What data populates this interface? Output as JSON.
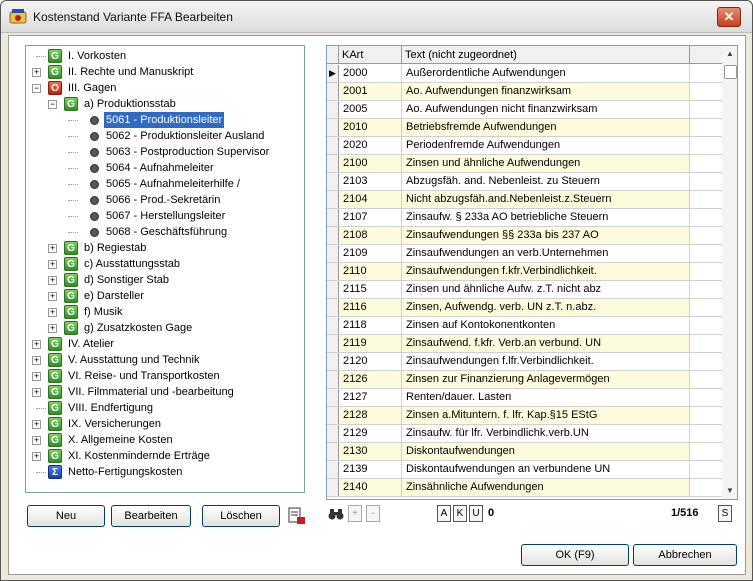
{
  "window": {
    "title": "Kostenstand Variante FFA Bearbeiten",
    "close_label": "✕"
  },
  "tree": [
    {
      "label": "I. Vorkosten",
      "icon": "G",
      "color": "green",
      "exp": "",
      "level": 0
    },
    {
      "label": "II. Rechte und Manuskript",
      "icon": "G",
      "color": "green",
      "exp": "+",
      "level": 0
    },
    {
      "label": "III. Gagen",
      "icon": "O",
      "color": "red",
      "exp": "−",
      "level": 0
    },
    {
      "label": "a) Produktionsstab",
      "icon": "G",
      "color": "green",
      "exp": "−",
      "level": 1
    },
    {
      "label": "5061 - Produktionsleiter",
      "icon": "radio",
      "level": 2,
      "selected": true
    },
    {
      "label": "5062 - Produktionsleiter Ausland",
      "icon": "radio",
      "level": 2
    },
    {
      "label": "5063 - Postproduction Supervisor",
      "icon": "radio",
      "level": 2
    },
    {
      "label": "5064 - Aufnahmeleiter",
      "icon": "radio",
      "level": 2
    },
    {
      "label": "5065 - Aufnahmeleiterhilfe /",
      "icon": "radio",
      "level": 2
    },
    {
      "label": "5066 - Prod.-Sekretärin",
      "icon": "radio",
      "level": 2
    },
    {
      "label": "5067 - Herstellungsleiter",
      "icon": "radio",
      "level": 2
    },
    {
      "label": "5068 - Geschäftsführung",
      "icon": "radio",
      "level": 2
    },
    {
      "label": "b) Regiestab",
      "icon": "G",
      "color": "green",
      "exp": "+",
      "level": 1
    },
    {
      "label": "c) Ausstattungsstab",
      "icon": "G",
      "color": "green",
      "exp": "+",
      "level": 1
    },
    {
      "label": "d) Sonstiger Stab",
      "icon": "G",
      "color": "green",
      "exp": "+",
      "level": 1
    },
    {
      "label": "e) Darsteller",
      "icon": "G",
      "color": "green",
      "exp": "+",
      "level": 1
    },
    {
      "label": "f) Musik",
      "icon": "G",
      "color": "green",
      "exp": "+",
      "level": 1
    },
    {
      "label": "g) Zusatzkosten Gage",
      "icon": "G",
      "color": "green",
      "exp": "+",
      "level": 1
    },
    {
      "label": "IV. Atelier",
      "icon": "G",
      "color": "green",
      "exp": "+",
      "level": 0
    },
    {
      "label": "V. Ausstattung und Technik",
      "icon": "G",
      "color": "green",
      "exp": "+",
      "level": 0
    },
    {
      "label": "VI. Reise- und Transportkosten",
      "icon": "G",
      "color": "green",
      "exp": "+",
      "level": 0
    },
    {
      "label": "VII. Filmmaterial und -bearbeitung",
      "icon": "G",
      "color": "green",
      "exp": "+",
      "level": 0
    },
    {
      "label": "VIII. Endfertigung",
      "icon": "G",
      "color": "green",
      "exp": "",
      "level": 0
    },
    {
      "label": "IX. Versicherungen",
      "icon": "G",
      "color": "green",
      "exp": "+",
      "level": 0
    },
    {
      "label": "X. Allgemeine Kosten",
      "icon": "G",
      "color": "green",
      "exp": "+",
      "level": 0
    },
    {
      "label": "XI. Kostenmindernde Erträge",
      "icon": "G",
      "color": "green",
      "exp": "+",
      "level": 0
    },
    {
      "label": "Netto-Fertigungskosten",
      "icon": "Σ",
      "color": "blue",
      "exp": "",
      "level": 0
    }
  ],
  "buttons": {
    "new": "Neu",
    "edit": "Bearbeiten",
    "delete": "Löschen",
    "ok": "OK (F9)",
    "cancel": "Abbrechen"
  },
  "grid": {
    "col_kart": "KArt",
    "col_text": "Text (nicht zugeordnet)",
    "rows": [
      {
        "kart": "2000",
        "text": "Außerordentliche Aufwendungen"
      },
      {
        "kart": "2001",
        "text": "Ao. Aufwendungen finanzwirksam"
      },
      {
        "kart": "2005",
        "text": "Ao. Aufwendungen nicht finanzwirksam"
      },
      {
        "kart": "2010",
        "text": "Betriebsfremde Aufwendungen"
      },
      {
        "kart": "2020",
        "text": "Periodenfremde Aufwendungen"
      },
      {
        "kart": "2100",
        "text": "Zinsen und ähnliche Aufwendungen"
      },
      {
        "kart": "2103",
        "text": "Abzugsfäh. and. Nebenleist. zu Steuern"
      },
      {
        "kart": "2104",
        "text": "Nicht abzugsfäh.and.Nebenleist.z.Steuern"
      },
      {
        "kart": "2107",
        "text": "Zinsaufw. § 233a AO betriebliche Steuern"
      },
      {
        "kart": "2108",
        "text": "Zinsaufwendungen §§ 233a bis 237 AO"
      },
      {
        "kart": "2109",
        "text": "Zinsaufwendungen an verb.Unternehmen"
      },
      {
        "kart": "2110",
        "text": "Zinsaufwendungen f.kfr.Verbindlichkeit."
      },
      {
        "kart": "2115",
        "text": "Zinsen und ähnliche Aufw. z.T. nicht abz"
      },
      {
        "kart": "2116",
        "text": "Zinsen, Aufwendg. verb. UN z.T. n.abz."
      },
      {
        "kart": "2118",
        "text": "Zinsen auf Kontokonentkonten"
      },
      {
        "kart": "2119",
        "text": "Zinsaufwend. f.kfr. Verb.an verbund. UN"
      },
      {
        "kart": "2120",
        "text": "Zinsaufwendungen f.lfr.Verbindlichkeit."
      },
      {
        "kart": "2126",
        "text": "Zinsen zur Finanzierung Anlagevermögen"
      },
      {
        "kart": "2127",
        "text": "Renten/dauer. Lasten"
      },
      {
        "kart": "2128",
        "text": "Zinsen a.Mituntern. f. lfr. Kap.§15 EStG"
      },
      {
        "kart": "2129",
        "text": "Zinsaufw. für lfr. Verbindlichk.verb.UN"
      },
      {
        "kart": "2130",
        "text": "Diskontaufwendungen"
      },
      {
        "kart": "2139",
        "text": "Diskontaufwendungen an verbundene UN"
      },
      {
        "kart": "2140",
        "text": "Zinsähnliche Aufwendungen"
      }
    ]
  },
  "nav": {
    "btn_a": "A",
    "btn_k": "K",
    "btn_u": "U",
    "count": "0",
    "position": "1/516",
    "btn_s": "S",
    "plus": "+",
    "minus": "-"
  }
}
